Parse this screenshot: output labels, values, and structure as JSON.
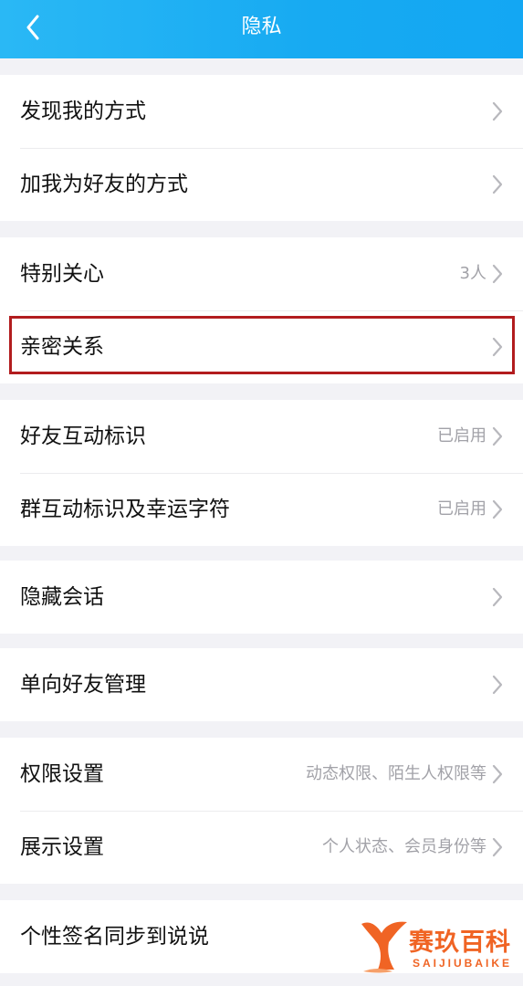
{
  "header": {
    "title": "隐私"
  },
  "groups": [
    {
      "items": [
        {
          "label": "发现我的方式",
          "value": ""
        },
        {
          "label": "加我为好友的方式",
          "value": ""
        }
      ]
    },
    {
      "items": [
        {
          "label": "特别关心",
          "value": "3人"
        },
        {
          "label": "亲密关系",
          "value": ""
        }
      ]
    },
    {
      "items": [
        {
          "label": "好友互动标识",
          "value": "已启用"
        },
        {
          "label": "群互动标识及幸运字符",
          "value": "已启用"
        }
      ]
    },
    {
      "items": [
        {
          "label": "隐藏会话",
          "value": ""
        }
      ]
    },
    {
      "items": [
        {
          "label": "单向好友管理",
          "value": ""
        }
      ]
    },
    {
      "items": [
        {
          "label": "权限设置",
          "value": "动态权限、陌生人权限等"
        },
        {
          "label": "展示设置",
          "value": "个人状态、会员身份等"
        }
      ]
    },
    {
      "items": [
        {
          "label": "个性签名同步到说说",
          "value": ""
        }
      ]
    }
  ],
  "watermark": {
    "name": "赛玖百科",
    "sub": "SAIJIUBAIKE"
  },
  "colors": {
    "header": "#17aaf2",
    "highlight": "#b21c1e",
    "watermark": "#f06424"
  }
}
